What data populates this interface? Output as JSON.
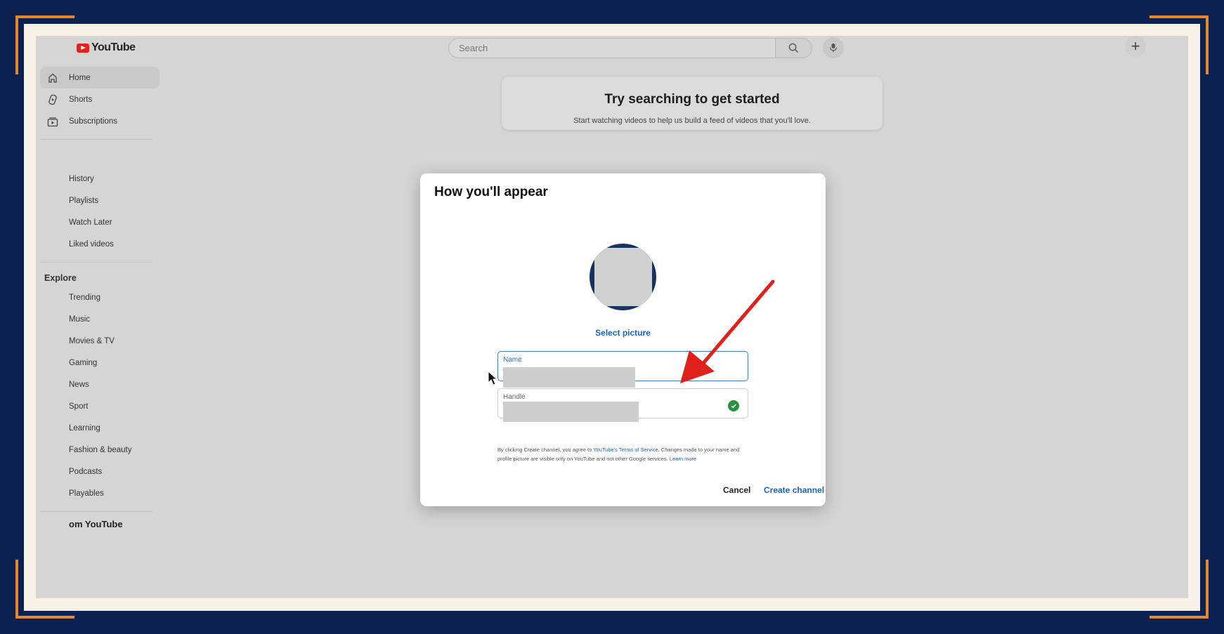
{
  "header": {
    "logo_text": "YouTube",
    "search_placeholder": "Search"
  },
  "sidebar": {
    "primary": [
      {
        "label": "Home",
        "icon": "home-icon",
        "active": true
      },
      {
        "label": "Shorts",
        "icon": "shorts-icon"
      },
      {
        "label": "Subscriptions",
        "icon": "subscriptions-icon"
      }
    ],
    "library": [
      "History",
      "Playlists",
      "Watch Later",
      "Liked videos"
    ],
    "explore_title": "Explore",
    "explore": [
      "Trending",
      "Music",
      "Movies & TV",
      "Gaming",
      "News",
      "Sport",
      "Learning",
      "Fashion & beauty",
      "Podcasts",
      "Playables"
    ],
    "more_title": "om YouTube"
  },
  "prompt": {
    "title": "Try searching to get started",
    "subtitle": "Start watching videos to help us build a feed of videos that you'll love."
  },
  "dialog": {
    "title": "How you'll appear",
    "select_picture": "Select picture",
    "name_label": "Name",
    "handle_label": "Handle",
    "terms_prefix": "By clicking Create channel, you agree to ",
    "terms_link": "YouTube's Terms of Service",
    "terms_middle": ". Changes made to your name and profile picture are visible only on YouTube and not other Google services. ",
    "learn_more": "Learn more",
    "cancel_label": "Cancel",
    "create_label": "Create channel"
  },
  "colors": {
    "accent": "#1a64c7",
    "annotation_arrow": "#e0211b",
    "frame_border": "#e58a2a",
    "background": "#0b2151"
  }
}
